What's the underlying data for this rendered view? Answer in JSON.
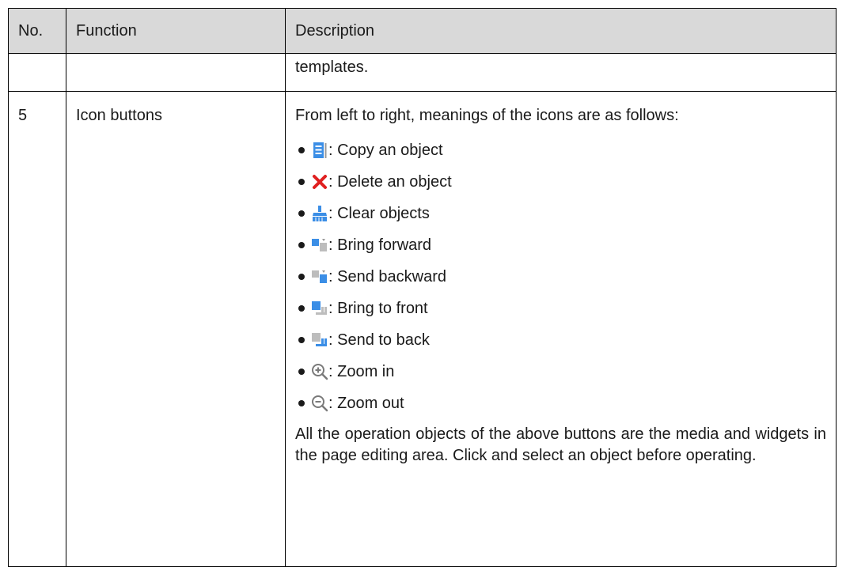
{
  "table": {
    "headers": {
      "no": "No.",
      "function": "Function",
      "description": "Description"
    },
    "continuation": {
      "no": "",
      "function": "",
      "description": "templates."
    },
    "row": {
      "no": "5",
      "function": "Icon buttons",
      "intro": "From left to right, meanings of the icons are as follows:",
      "items": [
        {
          "icon": "copy-icon",
          "label": ": Copy an object"
        },
        {
          "icon": "delete-icon",
          "label": ": Delete an object"
        },
        {
          "icon": "clear-broom-icon",
          "label": ": Clear objects"
        },
        {
          "icon": "bring-forward-icon",
          "label": ": Bring forward"
        },
        {
          "icon": "send-backward-icon",
          "label": ": Send backward"
        },
        {
          "icon": "bring-to-front-icon",
          "label": ": Bring to front"
        },
        {
          "icon": "send-to-back-icon",
          "label": ": Send to back"
        },
        {
          "icon": "zoom-in-icon",
          "label": ": Zoom in"
        },
        {
          "icon": "zoom-out-icon",
          "label": ": Zoom out"
        }
      ],
      "note": "All the operation objects of the above buttons are the media and widgets in the page editing area. Click and select an object before operating."
    }
  },
  "colors": {
    "header_bg": "#d9d9d9",
    "icon_blue": "#3b8ee6",
    "icon_red": "#e02020",
    "icon_gray": "#9a9a9a"
  }
}
